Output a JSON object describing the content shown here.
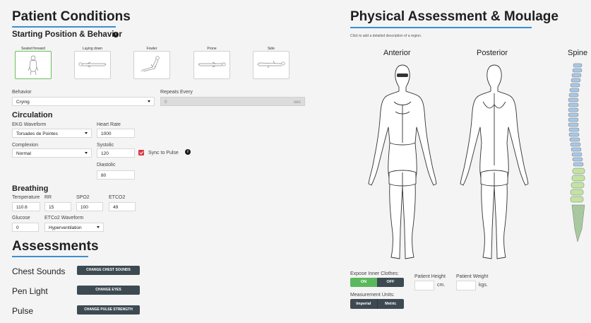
{
  "left": {
    "title": "Patient Conditions",
    "start_title": "Starting Position & Behavior",
    "positions": [
      {
        "label": "Seated forward",
        "selected": true
      },
      {
        "label": "Laying down",
        "selected": false
      },
      {
        "label": "Fowler",
        "selected": false
      },
      {
        "label": "Prone",
        "selected": false
      },
      {
        "label": "Side",
        "selected": false
      }
    ],
    "behavior": {
      "label": "Behavior",
      "value": "Crying"
    },
    "repeats": {
      "label": "Repeats Every",
      "value": "0",
      "unit": "sec"
    },
    "circulation": {
      "title": "Circulation",
      "ekg": {
        "label": "EKG Waveform",
        "value": "Torsades de Pointes"
      },
      "heart_rate": {
        "label": "Heart Rate",
        "value": "1000"
      },
      "complexion": {
        "label": "Complexion",
        "value": "Normal"
      },
      "systolic": {
        "label": "Systolic",
        "value": "120"
      },
      "sync": {
        "label": "Sync to Pulse",
        "checked": true
      },
      "diastolic": {
        "label": "Diastolic",
        "value": "80"
      }
    },
    "breathing": {
      "title": "Breathing",
      "temperature": {
        "label": "Temperature",
        "value": "110.6"
      },
      "rr": {
        "label": "RR",
        "value": "15"
      },
      "spo2": {
        "label": "SPO2",
        "value": "100"
      },
      "etco2": {
        "label": "ETCO2",
        "value": "49"
      },
      "glucose": {
        "label": "Glucose",
        "value": "0"
      },
      "etco2_wave": {
        "label": "ETCo2 Waveform",
        "value": "Hyperventilation"
      }
    },
    "assessments": {
      "title": "Assessments",
      "rows": [
        {
          "label": "Chest Sounds",
          "button": "CHANGE CHEST SOUNDS"
        },
        {
          "label": "Pen Light",
          "button": "CHANGE EYES"
        },
        {
          "label": "Pulse",
          "button": "CHANGE PULSE STRENGTH"
        }
      ]
    }
  },
  "right": {
    "title": "Physical Assessment & Moulage",
    "hint": "Click to add a detailed description of a region.",
    "views": {
      "anterior": "Anterior",
      "posterior": "Posterior",
      "spine": "Spine"
    },
    "expose": {
      "label": "Expose Inner Clothes:",
      "on": "ON",
      "off": "OFF",
      "active": "ON"
    },
    "units": {
      "label": "Measurement Units:",
      "imperial": "Imperial",
      "metric": "Metric"
    },
    "height": {
      "label": "Patient Height",
      "unit": "cm."
    },
    "weight": {
      "label": "Patient Weight",
      "unit": "kgs."
    }
  },
  "colors": {
    "accent_blue": "#3a8fd1",
    "selected_green": "#6cbf5c",
    "on_green": "#5cb85c",
    "button_dark": "#3d4a52",
    "checkbox_red": "#d93a45"
  }
}
